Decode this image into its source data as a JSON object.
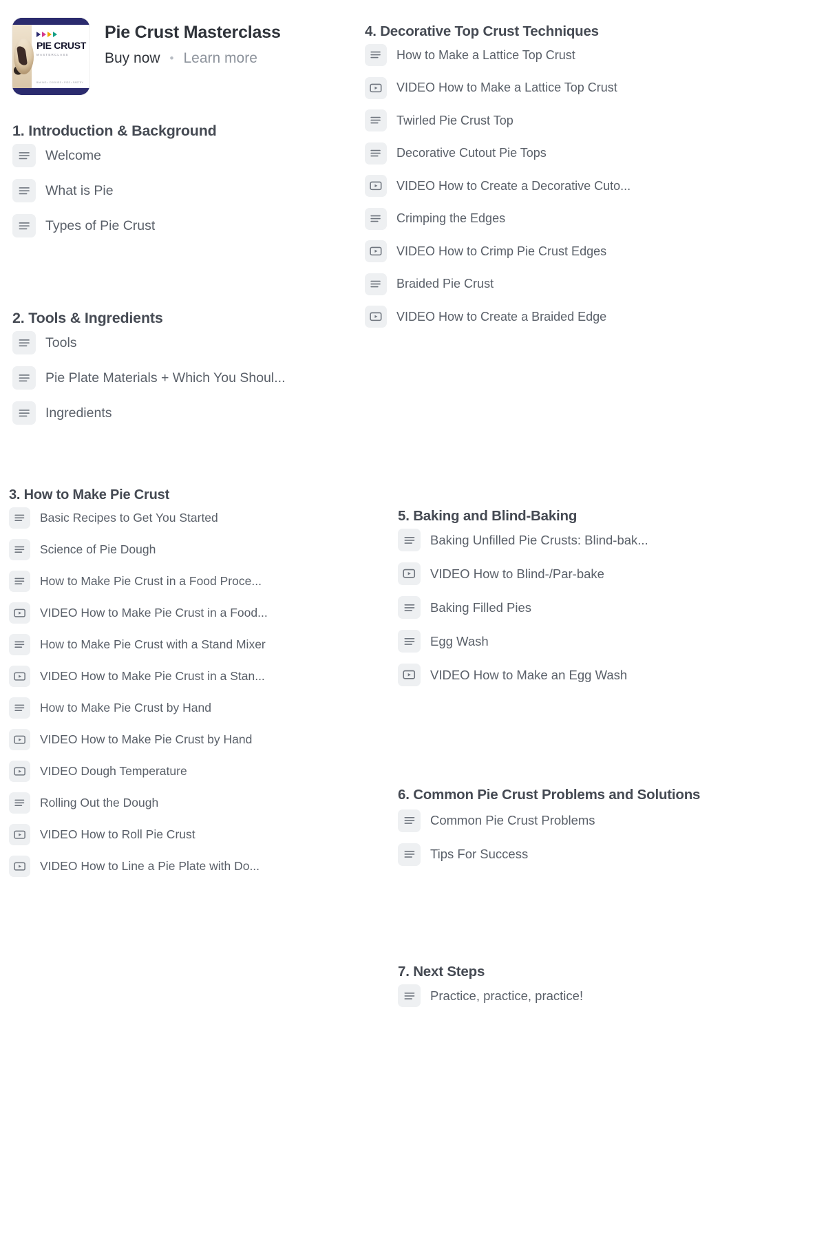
{
  "product": {
    "title": "Pie Crust Masterclass",
    "buy_label": "Buy now",
    "separator": "•",
    "learn_label": "Learn more",
    "thumbnail": {
      "brand_title": "PIE CRUST",
      "brand_subtitle": "MASTERCLASS",
      "brand_footer": "BAKING  •  COOKIES  •  PIES  •  PASTRY",
      "border_color": "#2b2b6e"
    }
  },
  "icons": {
    "lesson": "lesson-lines-icon",
    "video": "video-play-icon"
  },
  "colors": {
    "heading": "#454a53",
    "item_text": "#5a6069",
    "icon_bg": "#eef0f2",
    "icon_fg": "#6f757e",
    "link_muted": "#8d939c"
  },
  "sections": [
    {
      "id": "intro",
      "heading": "1. Introduction & Background",
      "items": [
        {
          "type": "lesson",
          "label": "Welcome"
        },
        {
          "type": "lesson",
          "label": "What is Pie"
        },
        {
          "type": "lesson",
          "label": "Types of Pie Crust"
        }
      ]
    },
    {
      "id": "tools",
      "heading": "2. Tools & Ingredients",
      "items": [
        {
          "type": "lesson",
          "label": "Tools"
        },
        {
          "type": "lesson",
          "label": "Pie Plate Materials + Which You Shoul..."
        },
        {
          "type": "lesson",
          "label": "Ingredients"
        }
      ]
    },
    {
      "id": "how-to-make",
      "heading": "3. How to Make Pie Crust",
      "items": [
        {
          "type": "lesson",
          "label": "Basic Recipes to Get You Started"
        },
        {
          "type": "lesson",
          "label": "Science of Pie Dough"
        },
        {
          "type": "lesson",
          "label": "How to Make Pie Crust in a Food Proce..."
        },
        {
          "type": "video",
          "label": "VIDEO How to Make Pie Crust in a Food..."
        },
        {
          "type": "lesson",
          "label": "How to Make Pie Crust with a Stand Mixer"
        },
        {
          "type": "video",
          "label": "VIDEO How to Make Pie Crust in a Stan..."
        },
        {
          "type": "lesson",
          "label": "How to Make Pie Crust by Hand"
        },
        {
          "type": "video",
          "label": "VIDEO How to Make Pie Crust by Hand"
        },
        {
          "type": "video",
          "label": "VIDEO Dough Temperature"
        },
        {
          "type": "lesson",
          "label": "Rolling Out the Dough"
        },
        {
          "type": "video",
          "label": "VIDEO How to Roll Pie Crust"
        },
        {
          "type": "video",
          "label": "VIDEO How to Line a Pie Plate with Do..."
        }
      ]
    },
    {
      "id": "decorative",
      "heading": "4. Decorative Top Crust Techniques",
      "items": [
        {
          "type": "lesson",
          "label": "How to Make a Lattice Top Crust"
        },
        {
          "type": "video",
          "label": "VIDEO How to Make a Lattice Top Crust"
        },
        {
          "type": "lesson",
          "label": "Twirled Pie Crust Top"
        },
        {
          "type": "lesson",
          "label": "Decorative Cutout Pie Tops"
        },
        {
          "type": "video",
          "label": "VIDEO How to Create a Decorative Cuto..."
        },
        {
          "type": "lesson",
          "label": "Crimping the Edges"
        },
        {
          "type": "video",
          "label": "VIDEO How to Crimp Pie Crust Edges"
        },
        {
          "type": "lesson",
          "label": "Braided Pie Crust"
        },
        {
          "type": "video",
          "label": "VIDEO How to Create a Braided Edge"
        }
      ]
    },
    {
      "id": "baking",
      "heading": "5. Baking and Blind-Baking",
      "items": [
        {
          "type": "lesson",
          "label": "Baking Unfilled Pie Crusts: Blind-bak..."
        },
        {
          "type": "video",
          "label": "VIDEO How to Blind-/Par-bake"
        },
        {
          "type": "lesson",
          "label": "Baking Filled Pies"
        },
        {
          "type": "lesson",
          "label": "Egg Wash"
        },
        {
          "type": "video",
          "label": "VIDEO How to Make an Egg Wash"
        }
      ]
    },
    {
      "id": "problems",
      "heading": "6. Common Pie Crust Problems and Solutions",
      "items": [
        {
          "type": "lesson",
          "label": "Common Pie Crust Problems"
        },
        {
          "type": "lesson",
          "label": "Tips For Success"
        }
      ]
    },
    {
      "id": "next-steps",
      "heading": "7. Next Steps",
      "items": [
        {
          "type": "lesson",
          "label": "Practice, practice, practice!"
        }
      ]
    }
  ]
}
